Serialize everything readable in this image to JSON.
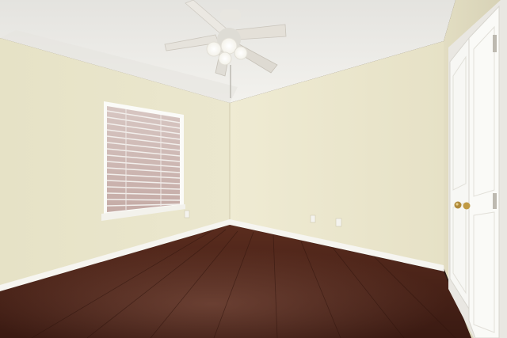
{
  "scene": {
    "colors": {
      "ceiling": "#f1f0ec",
      "left_wall": "#e7e3c9",
      "back_wall": "#ece8cf",
      "right_wall": "#ded9bd",
      "floor": "#4a2418",
      "baseboard": "#f6f5f0",
      "door": "#f7f7f4",
      "window_glass": "#c9b2ad",
      "fan_blade": "#ebe8e2"
    },
    "icons": {
      "ceiling_fan": "ceiling-fan-icon",
      "window": "window-blinds-icon",
      "door": "closet-door-icon",
      "door_knob": "door-knob-icon",
      "outlet": "power-outlet-icon"
    }
  }
}
